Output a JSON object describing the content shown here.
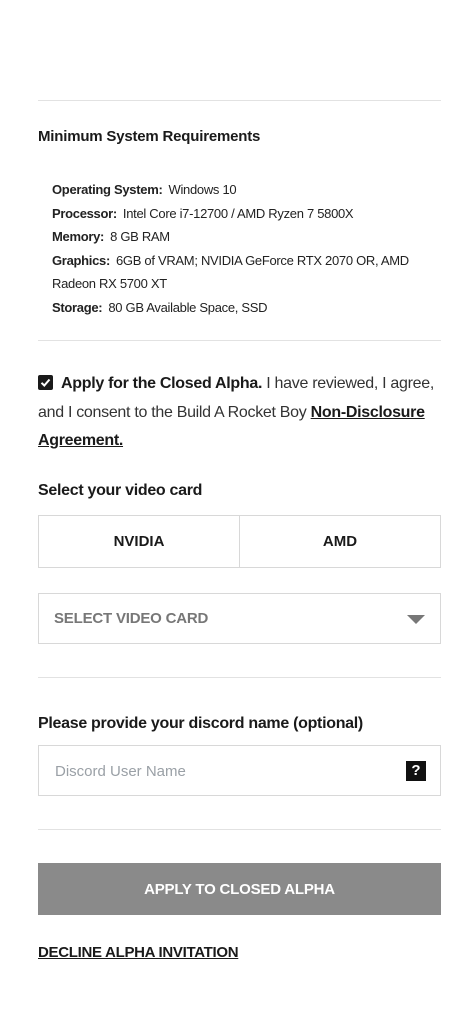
{
  "requirements": {
    "title": "Minimum System Requirements",
    "items": [
      {
        "key": "Operating System:",
        "value": "Windows 10"
      },
      {
        "key": "Processor:",
        "value": "Intel Core i7-12700 / AMD Ryzen 7 5800X"
      },
      {
        "key": "Memory:",
        "value": "8 GB RAM"
      },
      {
        "key": "Graphics:",
        "value": "6GB of VRAM; NVIDIA GeForce RTX 2070 OR, AMD Radeon RX 5700 XT"
      },
      {
        "key": "Storage:",
        "value": "80 GB Available Space, SSD"
      }
    ]
  },
  "consent": {
    "checked": true,
    "strong": "Apply for the Closed Alpha.",
    "text": "I have reviewed, I agree, and I consent to the Build A Rocket Boy",
    "link": "Non-Disclosure Agreement."
  },
  "video_card": {
    "label": "Select your video card",
    "options": [
      "NVIDIA",
      "AMD"
    ],
    "select_placeholder": "SELECT VIDEO CARD"
  },
  "discord": {
    "label": "Please provide your discord name (optional)",
    "placeholder": "Discord User Name",
    "help": "?"
  },
  "actions": {
    "apply": "APPLY TO CLOSED ALPHA",
    "decline": "DECLINE ALPHA INVITATION"
  },
  "colors": {
    "button_bg": "#8a8a8a",
    "divider": "#e2e2e2",
    "text": "#1a1a1a"
  }
}
